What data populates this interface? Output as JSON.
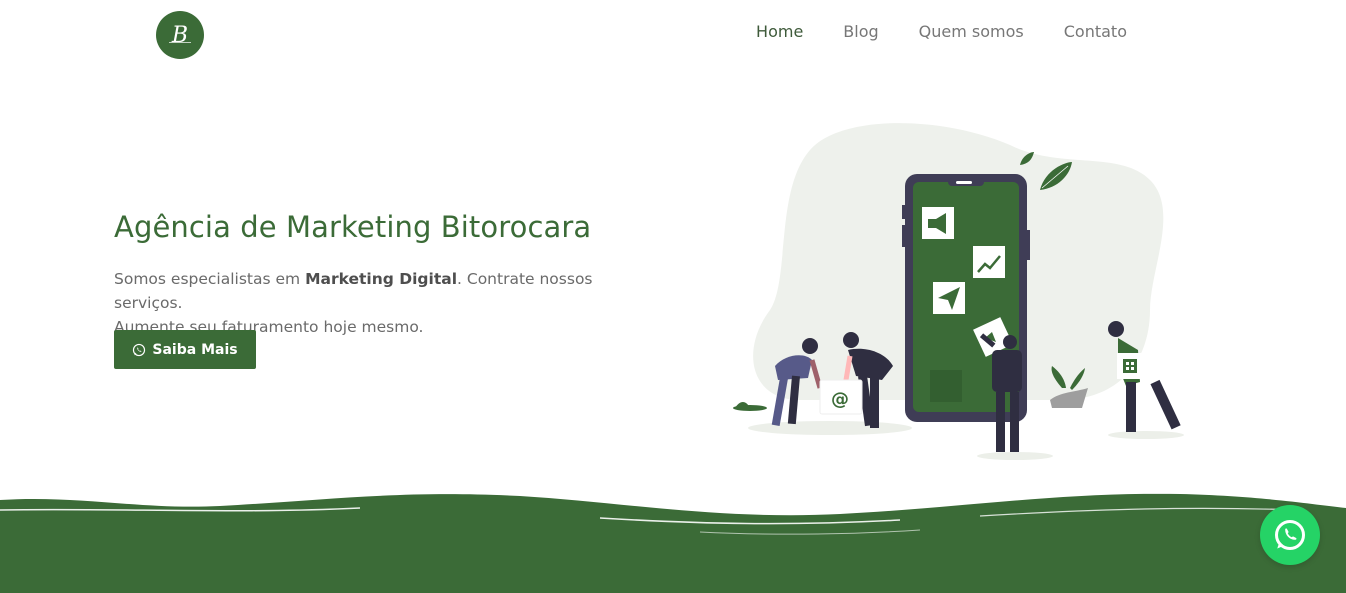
{
  "header": {
    "logo_letter": "B",
    "nav": [
      {
        "label": "Home",
        "active": true
      },
      {
        "label": "Blog",
        "active": false
      },
      {
        "label": "Quem somos",
        "active": false
      },
      {
        "label": "Contato",
        "active": false
      }
    ]
  },
  "hero": {
    "title": "Agência de Marketing Bitorocara",
    "text_before": "Somos especialistas em ",
    "text_bold": "Marketing Digital",
    "text_after": ". Contrate nossos serviços.",
    "text_line2": "Aumente seu faturamento hoje mesmo.",
    "cta_label": "Saiba Mais",
    "illustration_at": "@"
  },
  "colors": {
    "brand_green": "#3b6b37",
    "whatsapp_green": "#25d366",
    "phone_purple": "#3f3d56"
  },
  "icons": [
    "whatsapp-icon",
    "megaphone-icon",
    "chart-icon",
    "paper-plane-icon",
    "spreadsheet-icon",
    "leaf-icon"
  ]
}
